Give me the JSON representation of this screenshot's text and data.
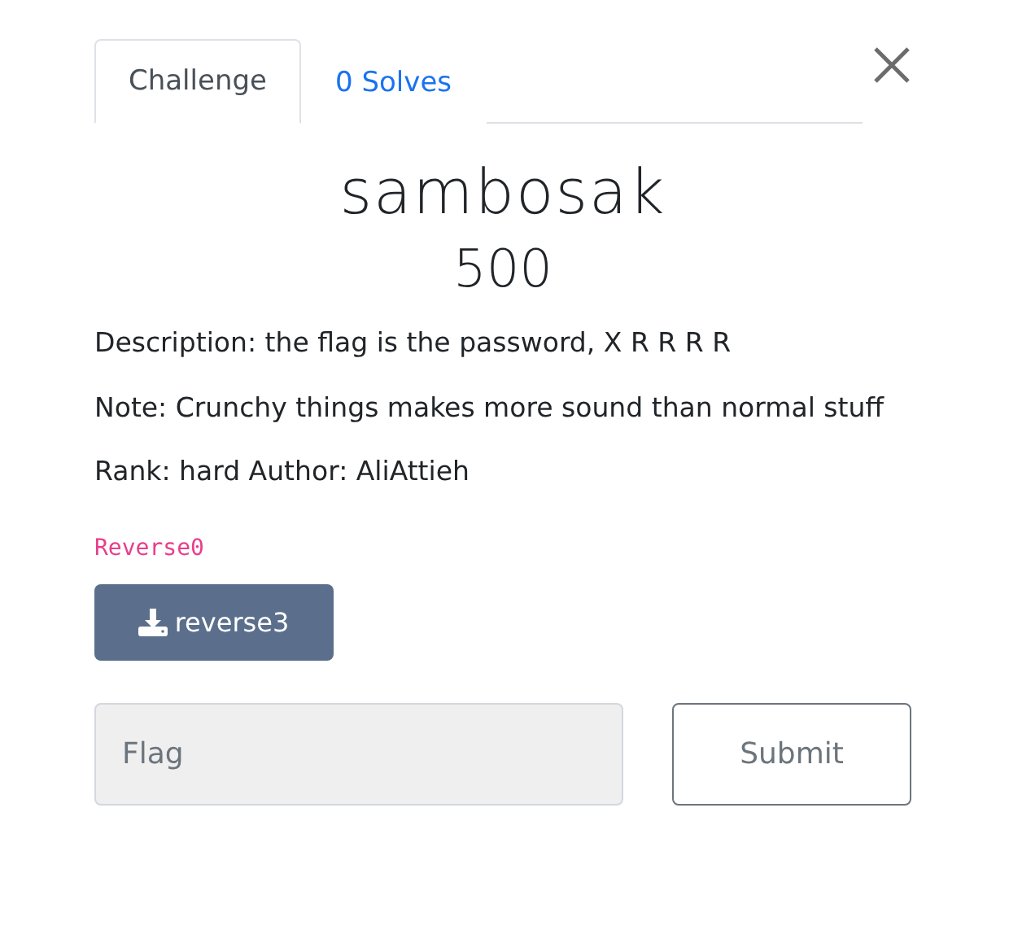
{
  "tabs": [
    {
      "label": "Challenge",
      "selected": true
    },
    {
      "label": "0 Solves",
      "selected": false
    }
  ],
  "challenge": {
    "name": "sambosak",
    "points": "500",
    "description": [
      "Description: the flag is the password, X R R R R",
      "Note: Crunchy things makes more sound than normal stuff",
      "Rank: hard Author: AliAttieh"
    ],
    "category": "Reverse0"
  },
  "files": [
    {
      "label": "reverse3"
    }
  ],
  "form": {
    "placeholder": "Flag",
    "submit": "Submit"
  }
}
